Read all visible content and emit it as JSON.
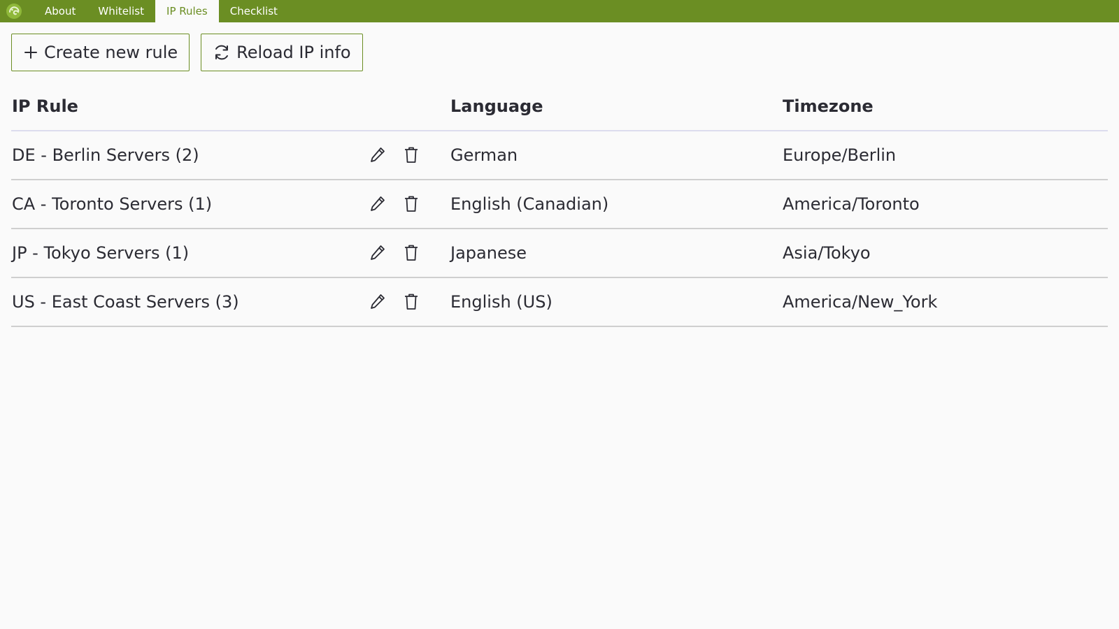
{
  "nav": {
    "logo_icon": "chameleon-logo-icon",
    "tabs": [
      {
        "label": "About",
        "active": false
      },
      {
        "label": "Whitelist",
        "active": false
      },
      {
        "label": "IP Rules",
        "active": true
      },
      {
        "label": "Checklist",
        "active": false
      }
    ],
    "accent_color": "#6b8e23"
  },
  "toolbar": {
    "create_label": "Create new rule",
    "create_icon": "plus-icon",
    "reload_label": "Reload IP info",
    "reload_icon": "refresh-icon"
  },
  "table": {
    "headers": {
      "rule": "IP Rule",
      "language": "Language",
      "timezone": "Timezone"
    },
    "rows": [
      {
        "rule": "DE - Berlin Servers (2)",
        "language": "German",
        "timezone": "Europe/Berlin"
      },
      {
        "rule": "CA - Toronto Servers (1)",
        "language": "English (Canadian)",
        "timezone": "America/Toronto"
      },
      {
        "rule": "JP - Tokyo Servers (1)",
        "language": "Japanese",
        "timezone": "Asia/Tokyo"
      },
      {
        "rule": "US - East Coast Servers (3)",
        "language": "English (US)",
        "timezone": "America/New_York"
      }
    ],
    "row_icons": [
      "pencil-icon",
      "trash-icon"
    ]
  }
}
